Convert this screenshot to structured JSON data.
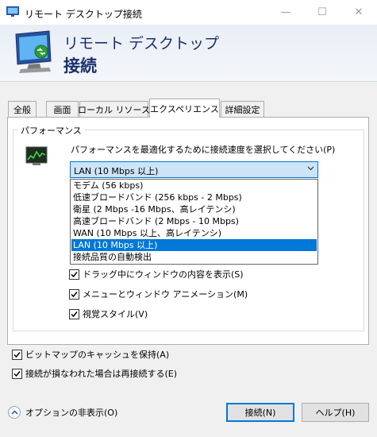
{
  "window": {
    "title": "リモート デスクトップ接続",
    "minimize_glyph": "—",
    "maximize_glyph": "☐",
    "close_glyph": "✕"
  },
  "header": {
    "line1": "リモート デスクトップ",
    "line2": "接続"
  },
  "tabs": [
    {
      "label": "全般"
    },
    {
      "label": "画面"
    },
    {
      "label": "ローカル リソース"
    },
    {
      "label": "エクスペリエンス",
      "active": true
    },
    {
      "label": "詳細設定"
    }
  ],
  "performance": {
    "legend": "パフォーマンス",
    "instruction": "パフォーマンスを最適化するために接続速度を選択してください(P)",
    "selected_value": "LAN (10 Mbps 以上)",
    "options": [
      "モデム (56 kbps)",
      "低速ブロードバンド (256 kbps - 2 Mbps)",
      "衛星 (2 Mbps -16 Mbps、高レイテンシ)",
      "高速ブロードバンド (2 Mbps - 10 Mbps)",
      "WAN (10 Mbps 以上、高レイテンシ)",
      "LAN (10 Mbps 以上)",
      "接続品質の自動検出"
    ],
    "selected_index": 5,
    "checkboxes": [
      {
        "label": "ドラッグ中にウィンドウの内容を表示(S)",
        "checked": true
      },
      {
        "label": "メニューとウィンドウ アニメーション(M)",
        "checked": true
      },
      {
        "label": "視覚スタイル(V)",
        "checked": true
      }
    ]
  },
  "bottom_checkboxes": [
    {
      "label": "ビットマップのキャッシュを保持(A)",
      "checked": true
    },
    {
      "label": "接続が損なわれた場合は再接続する(E)",
      "checked": true
    }
  ],
  "footer": {
    "options_label": "オプションの非表示(O)",
    "connect_label": "接続(N)",
    "help_label": "ヘルプ(H)"
  },
  "colors": {
    "accent": "#0078d7",
    "header_text": "#1b2f6e"
  }
}
